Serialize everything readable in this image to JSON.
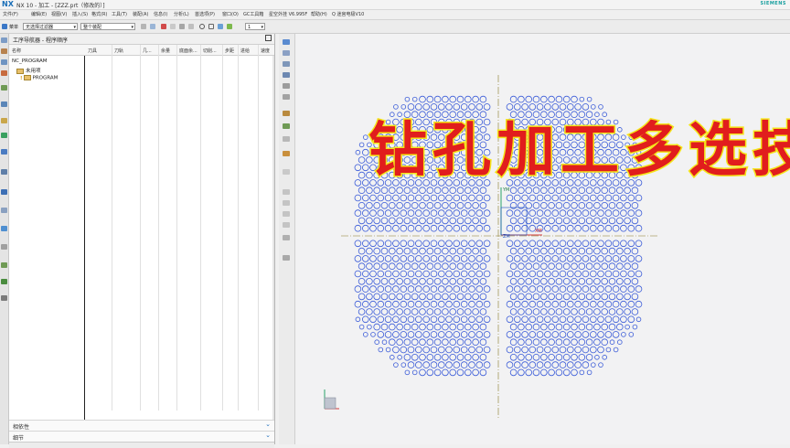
{
  "window": {
    "logo": "NX",
    "title": "NX 10 - 加工 - [ZZZ.prt（修改的）]",
    "brand": "SIEMENS"
  },
  "menu": [
    "文件(F)",
    "编辑(E)",
    "视图(V)",
    "插入(S)",
    "格式(R)",
    "工具(T)",
    "装配(A)",
    "信息(I)",
    "分析(L)",
    "首选项(P)",
    "窗口(O)",
    "GC工具箱",
    "星空外挂 V6.995F",
    "帮助(H)",
    "Q 迷宫电极V10"
  ],
  "toolbar": {
    "menu_button": "菜单",
    "filter_value": "无选择过滤器",
    "scope_value": "整个装配",
    "count_value": "1"
  },
  "navigator": {
    "title": "工序导航器 - 程序顺序",
    "columns": [
      "名称",
      "刀具",
      "刀轨",
      "几...",
      "余量",
      "底面余...",
      "切削...",
      "步距",
      "进给",
      "速度"
    ],
    "tree": [
      {
        "label": "NC_PROGRAM",
        "level": 0
      },
      {
        "label": "未用项",
        "level": 1
      },
      {
        "label": "PROGRAM",
        "level": 1
      }
    ],
    "sections": [
      "相依性",
      "细节"
    ]
  },
  "graphics": {
    "overlay_title": "钻孔加工多选技巧",
    "wcs_labels": [
      "YM",
      "XM",
      "ZM"
    ],
    "hole_color": "#3a5bd8",
    "axis_color": "#8a7a2a"
  }
}
